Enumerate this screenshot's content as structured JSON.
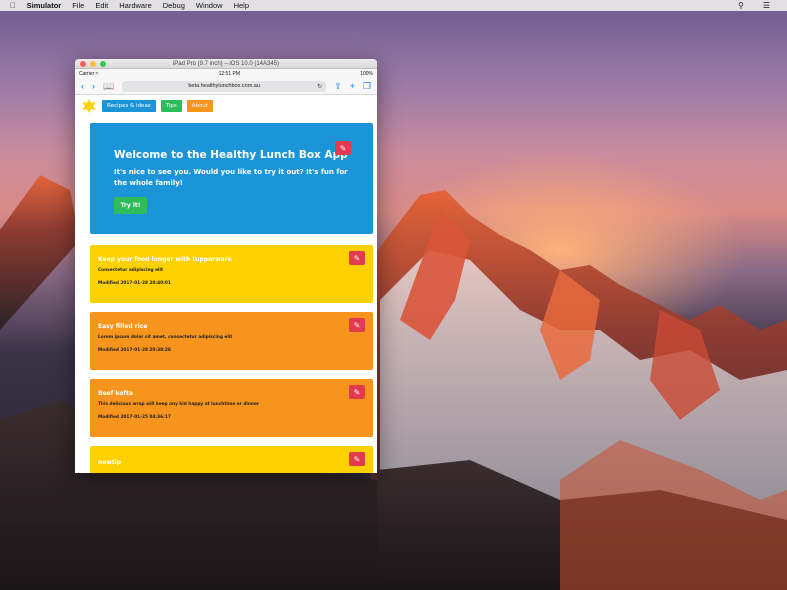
{
  "menubar": {
    "app_name": "Simulator",
    "items": [
      "File",
      "Edit",
      "Hardware",
      "Debug",
      "Window",
      "Help"
    ]
  },
  "window": {
    "title": "iPad Pro (9.7 inch) – iOS 10.0 (14A345)"
  },
  "status_bar": {
    "carrier": "Carrier ≈",
    "time": "12:51 PM",
    "battery": "100%"
  },
  "browser": {
    "url": "beta.healthylunchbox.com.au"
  },
  "nav": {
    "buttons": [
      {
        "label": "Recipes & ideas",
        "color": "#1c95d8"
      },
      {
        "label": "Tips",
        "color": "#2ebb5a"
      },
      {
        "label": "About",
        "color": "#f7941d"
      }
    ]
  },
  "hero": {
    "title": "Welcome to the Healthy Lunch Box App",
    "text": "It's nice to see you. Would you like to try it out? It's fun for the whole family!",
    "button": "Try it!"
  },
  "cards": [
    {
      "title": "Keep your food longer with tupperware",
      "desc": "Consectetur adipiscing elit",
      "meta": "Modified 2017-01-28 20:40:01",
      "color": "#fdd100"
    },
    {
      "title": "Easy filled rice",
      "desc": "Lorem ipsum dolor sit amet, consectetur adipiscing elit",
      "meta": "Modified 2017-01-28 20:38:28",
      "color": "#f7941d"
    },
    {
      "title": "Beef kofta",
      "desc": "This delicious wrap will keep any kid happy at lunchtime or dinner",
      "meta": "Modified 2017-01-25 04:36:17",
      "color": "#f7941d"
    },
    {
      "title": "newtip",
      "desc": "",
      "meta": "",
      "color": "#fdd100"
    }
  ]
}
